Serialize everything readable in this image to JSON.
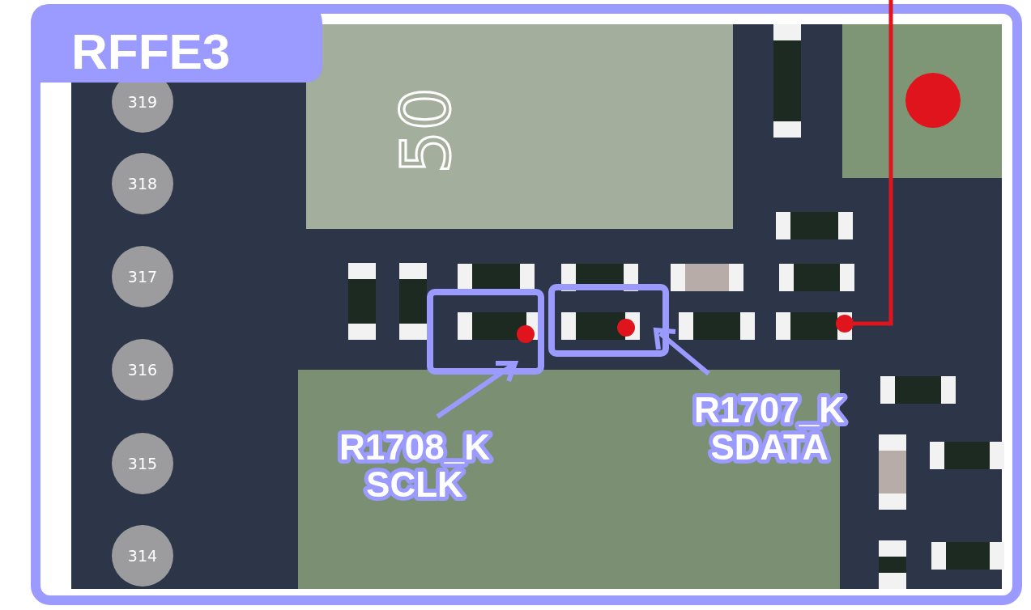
{
  "title": "RFFE3",
  "chip_label": "50",
  "pads": [
    {
      "label": "319"
    },
    {
      "label": "318"
    },
    {
      "label": "317"
    },
    {
      "label": "316"
    },
    {
      "label": "315"
    },
    {
      "label": "314"
    }
  ],
  "callouts": [
    {
      "ref": "R1708_K",
      "signal": "SCLK"
    },
    {
      "ref": "R1707_K",
      "signal": "SDATA"
    }
  ]
}
